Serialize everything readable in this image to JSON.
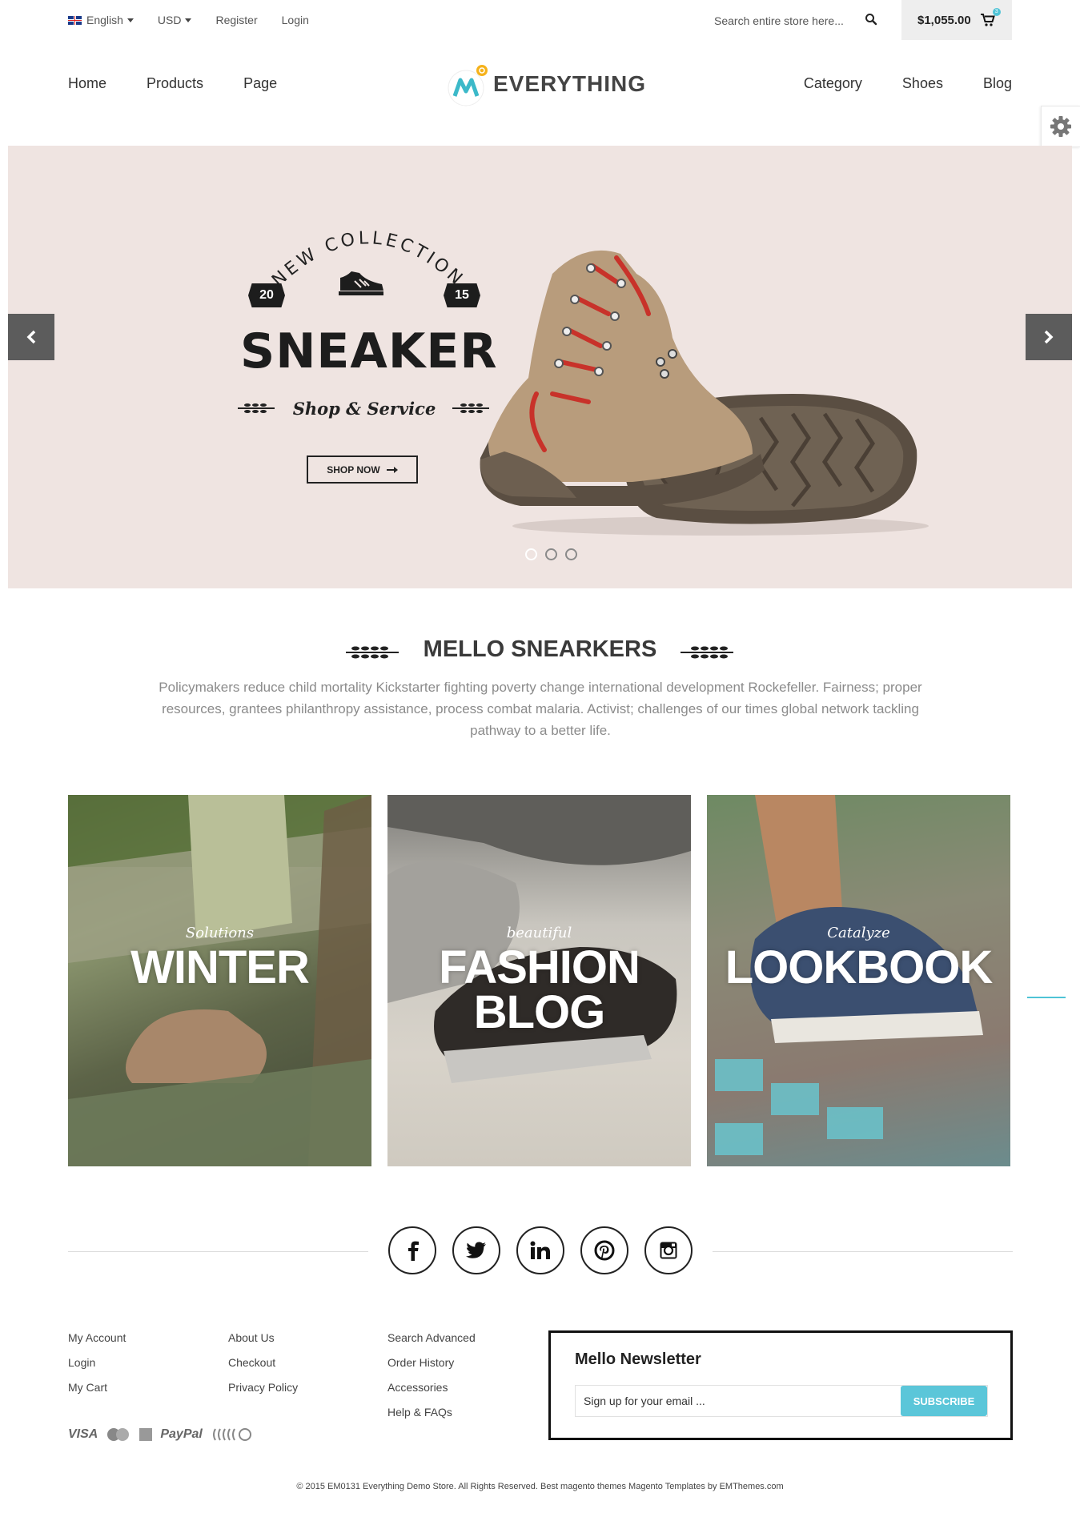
{
  "topbar": {
    "language": "English",
    "currency": "USD",
    "register": "Register",
    "login": "Login",
    "search_placeholder": "Search entire store here...",
    "cart_total": "$1,055.00",
    "cart_count": "3"
  },
  "nav": {
    "left": [
      "Home",
      "Products",
      "Page"
    ],
    "right": [
      "Category",
      "Shoes",
      "Blog"
    ],
    "logo_text": "EVERYTHING"
  },
  "hero": {
    "arc_text": "NEW COLLECTION",
    "year_left": "20",
    "year_right": "15",
    "title": "SNEAKER",
    "subtitle": "Shop & Service",
    "cta": "SHOP NOW",
    "slides": 3,
    "active_slide": 1
  },
  "intro": {
    "title": "MELLO SNEARKERS",
    "text": "Policymakers reduce child mortality Kickstarter fighting poverty change international development Rockefeller. Fairness; proper resources, grantees philanthropy assistance, process combat malaria. Activist; challenges of our times global network tackling pathway to a better life."
  },
  "tiles": [
    {
      "tag": "Solutions",
      "name": "WINTER"
    },
    {
      "tag": "beautiful",
      "name": "FASHION BLOG"
    },
    {
      "tag": "Catalyze",
      "name": "LOOKBOOK"
    }
  ],
  "social": [
    "facebook-icon",
    "twitter-icon",
    "linkedin-icon",
    "pinterest-icon",
    "instagram-icon"
  ],
  "footer": {
    "col1": [
      "My Account",
      "Login",
      "My Cart"
    ],
    "col2": [
      "About Us",
      "Checkout",
      "Privacy Policy"
    ],
    "col3": [
      "Search Advanced",
      "Order History",
      "Accessories",
      "Help & FAQs"
    ],
    "payments": [
      "VISA",
      "PayPal"
    ],
    "newsletter_title": "Mello Newsletter",
    "newsletter_placeholder": "Sign up for your email ...",
    "subscribe": "SUBSCRIBE",
    "copyright": "© 2015 EM0131 Everything Demo Store. All Rights Reserved. Best magento themes Magento Templates by EMThemes.com"
  },
  "colors": {
    "accent": "#5bc6d9",
    "hero_bg": "#efe4e1",
    "dark": "#1d1d1d"
  }
}
